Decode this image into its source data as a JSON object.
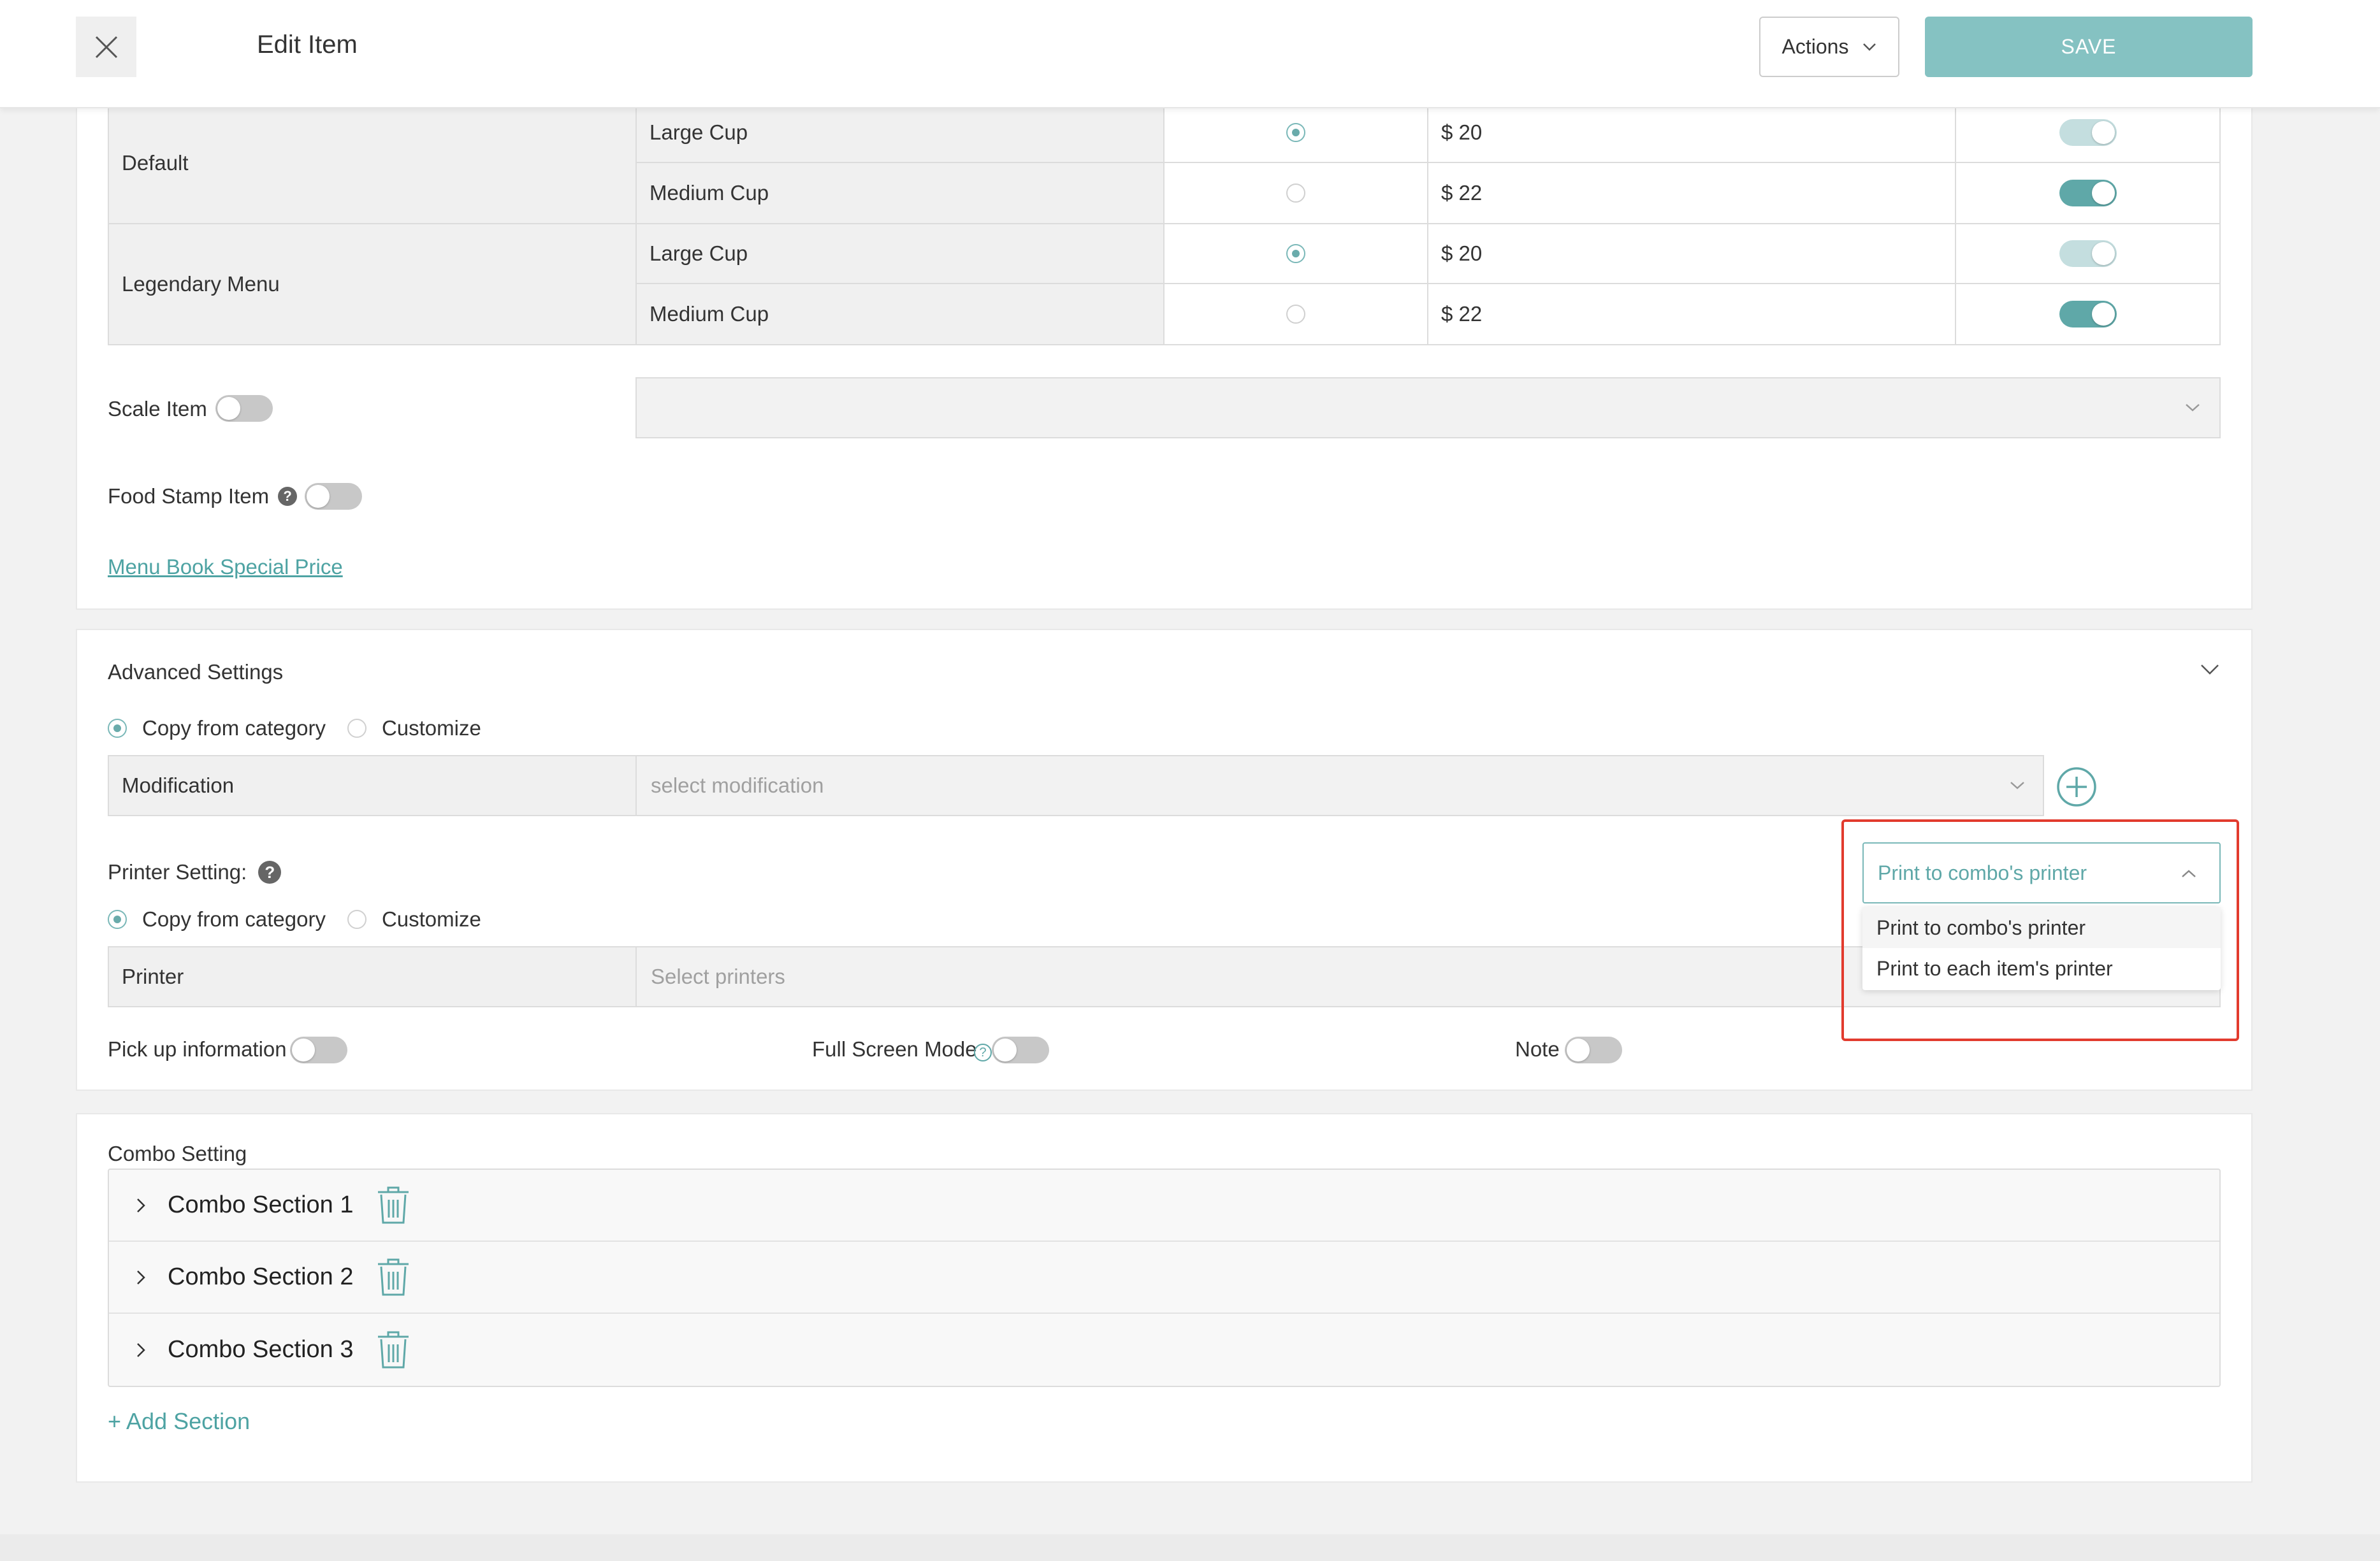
{
  "header": {
    "title": "Edit Item",
    "actions_label": "Actions",
    "save_label": "SAVE"
  },
  "price_table": {
    "groups": [
      {
        "name": "Default",
        "rows": [
          {
            "size": "Large Cup",
            "default": true,
            "price": "$ 20",
            "enabled": "light"
          },
          {
            "size": "Medium Cup",
            "default": false,
            "price": "$ 22",
            "enabled": "on"
          }
        ]
      },
      {
        "name": "Legendary Menu",
        "rows": [
          {
            "size": "Large Cup",
            "default": true,
            "price": "$ 20",
            "enabled": "light"
          },
          {
            "size": "Medium Cup",
            "default": false,
            "price": "$ 22",
            "enabled": "on"
          }
        ]
      }
    ]
  },
  "scale_item_label": "Scale Item",
  "food_stamp_label": "Food Stamp Item",
  "menu_book_link": "Menu Book Special Price",
  "advanced": {
    "title": "Advanced Settings",
    "copy_from_category": "Copy from category",
    "customize": "Customize",
    "modification_label": "Modification",
    "modification_placeholder": "select modification"
  },
  "printer": {
    "title": "Printer Setting:",
    "copy_from_category": "Copy from category",
    "customize": "Customize",
    "printer_label": "Printer",
    "printer_placeholder": "Select printers",
    "dropdown_selected": "Print to combo's printer",
    "dropdown_options": [
      "Print to combo's printer",
      "Print to each item's printer"
    ]
  },
  "toggles_row": {
    "pickup": "Pick up information",
    "fullscreen": "Full Screen Mode",
    "note": "Note"
  },
  "combo": {
    "title": "Combo Setting",
    "sections": [
      "Combo Section 1",
      "Combo Section 2",
      "Combo Section 3"
    ],
    "add_section": "+ Add Section"
  },
  "colors": {
    "accent": "#5fa8a8",
    "save_button": "#85c2c2",
    "highlight_box": "#e23b2e"
  }
}
